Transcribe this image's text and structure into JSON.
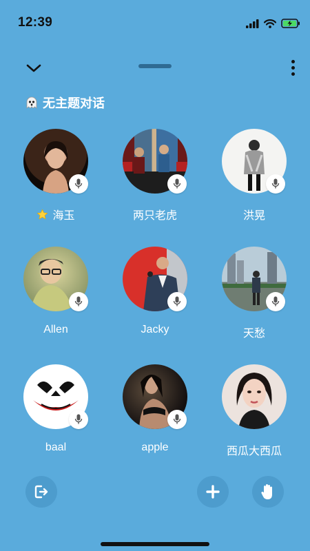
{
  "status_bar": {
    "time": "12:39"
  },
  "room": {
    "title": "无主题对话"
  },
  "members": [
    {
      "name": "海玉",
      "avatar": "photo-woman-dark-bg",
      "badge": "star-icon",
      "mic": "mic-muted"
    },
    {
      "name": "两只老虎",
      "avatar": "photo-group",
      "mic": "mic-muted"
    },
    {
      "name": "洪晃",
      "avatar": "photo-woman-white-bg",
      "mic": "mic-muted"
    },
    {
      "name": "Allen",
      "avatar": "photo-man-glasses",
      "mic": "mic-muted"
    },
    {
      "name": "Jacky",
      "avatar": "photo-man-suit-red-bg",
      "mic": "mic-muted"
    },
    {
      "name": "天愁",
      "avatar": "photo-man-city",
      "mic": "mic-muted"
    },
    {
      "name": "baal",
      "avatar": "joker-face",
      "mic": "mic-muted"
    },
    {
      "name": "apple",
      "avatar": "photo-woman-dark",
      "mic": "mic-muted"
    },
    {
      "name": "西瓜大西瓜",
      "avatar": "photo-woman-portrait"
    }
  ],
  "colors": {
    "background": "#5aabdc",
    "button_bg": "#4d9ccd",
    "grabber": "#2f6b93"
  }
}
